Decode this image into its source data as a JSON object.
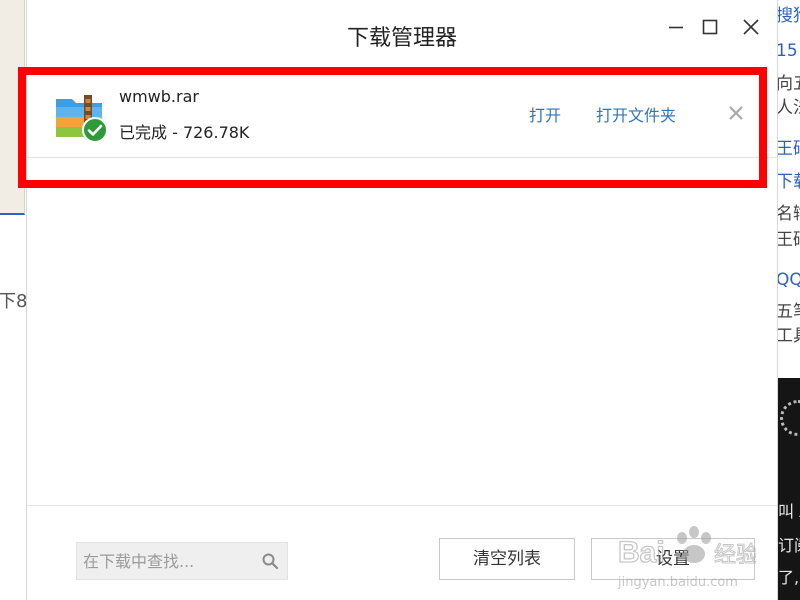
{
  "background_page": {
    "left_fragment": "下8",
    "right_fragments": [
      {
        "text": "搜狗",
        "color": "blue"
      },
      {
        "text": "15",
        "color": "blue"
      },
      {
        "text": "向五",
        "color": "gray"
      },
      {
        "text": "人法",
        "color": "gray"
      },
      {
        "text": "王码",
        "color": "blue"
      },
      {
        "text": "下载",
        "color": "blue"
      },
      {
        "text": "名输",
        "color": "gray"
      },
      {
        "text": "王码",
        "color": "gray"
      },
      {
        "text": "QQ",
        "color": "blue"
      },
      {
        "text": "五笔",
        "color": "gray"
      },
      {
        "text": "工具",
        "color": "gray"
      }
    ],
    "right_photo_fragments": [
      "叫 A",
      "订阅",
      "了,"
    ]
  },
  "dialog": {
    "title": "下载管理器",
    "window_controls": [
      "minimize-icon",
      "maximize-icon",
      "close-icon"
    ]
  },
  "download_item": {
    "file_name": "wmwb.rar",
    "status": "已完成 - 726.78K",
    "icon": "archive-file-icon",
    "badge_icon": "check-circle-icon",
    "actions": {
      "open": "打开",
      "open_folder": "打开文件夹"
    },
    "remove_icon": "remove-x-icon"
  },
  "footer": {
    "search": {
      "placeholder": "在下载中查找...",
      "value": ""
    },
    "clear_list": "清空列表",
    "settings": "设置"
  },
  "watermark": {
    "brand": "Bai 经验",
    "url": "jingyan.baidu.com"
  },
  "colors": {
    "link": "#2f74c0",
    "highlight": "#ff0000",
    "success_badge": "#2e9a3a",
    "background_link": "#2c63b8"
  }
}
